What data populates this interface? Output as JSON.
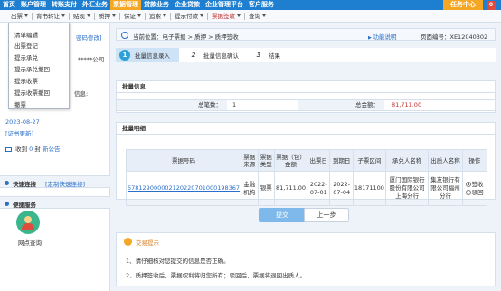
{
  "topnav": {
    "items": [
      "首页",
      "账户管理",
      "转账支付",
      "外汇业务",
      "票据管理",
      "贷款业务",
      "企业贷款",
      "企业管理平台",
      "客户服务"
    ],
    "active_index": 4,
    "task_center": "任务中心",
    "task_count": "0"
  },
  "subnav": {
    "items": [
      "出票",
      "背书转让",
      "贴现",
      "质押",
      "保证",
      "追索",
      "提示付款",
      "票据签收",
      "查询"
    ]
  },
  "dropdown": {
    "items": [
      "清单编辑",
      "出票登记",
      "提示承兑",
      "提示承兑撤回",
      "提示收票",
      "提示收票撤回",
      "撤票"
    ]
  },
  "sidebar": {
    "modify_pwd": "密码修改]",
    "company_suffix": "*****公司",
    "info_label": "信息:",
    "date": "2023-08-27",
    "cert_update": "[证书更新]",
    "received_label": "收到",
    "received_count": "0",
    "received_suffix": "封",
    "new_notice": "新公告",
    "quick_title": "快速连接",
    "quick_custom": "[定制快速连接]",
    "service_title": "便捷服务",
    "netpoint_label": "网点查询"
  },
  "breadcrumb": {
    "text": "当前位置：电子票据 > 质押 > 质押签收",
    "help": "功能说明",
    "page_no": "页面编号：XE12040302"
  },
  "steps": [
    {
      "num": "1",
      "label": "批量信息录入"
    },
    {
      "num": "2",
      "label": "批量信息确认"
    },
    {
      "num": "3",
      "label": "结果"
    }
  ],
  "batch_info": {
    "title": "批量信息",
    "total_label": "总笔数：",
    "total_value": "1",
    "amount_label": "总金额：",
    "amount_value": "81,711.00"
  },
  "batch_detail": {
    "title": "批量明细",
    "headers": [
      "票据号码",
      "票据来源",
      "票据类型",
      "票据（包）金额",
      "出票日",
      "到期日",
      "子票区间",
      "承兑人名称",
      "出质人名称",
      "操作"
    ],
    "rows": [
      {
        "bill_no": "578129000002120220701000198367",
        "source": "金融机构",
        "type": "银票",
        "amount": "81,711.00",
        "issue_date": "2022-07-01",
        "due_date": "2022-07-04",
        "range": "18171100",
        "acceptor": "厦门国际银行股份有限公司上海分行",
        "pledgor": "集友银行有限公司福州分行",
        "op_sign": "签收",
        "op_reject": "驳回"
      }
    ]
  },
  "buttons": {
    "submit": "提交",
    "prev": "上一步"
  },
  "tips": {
    "title": "交易提示",
    "lines": [
      "1、请仔细核对您提交的信息是否正确。",
      "2、质押签收后，票据权利将归您所有；驳回后，票据将退回出质人。"
    ]
  }
}
